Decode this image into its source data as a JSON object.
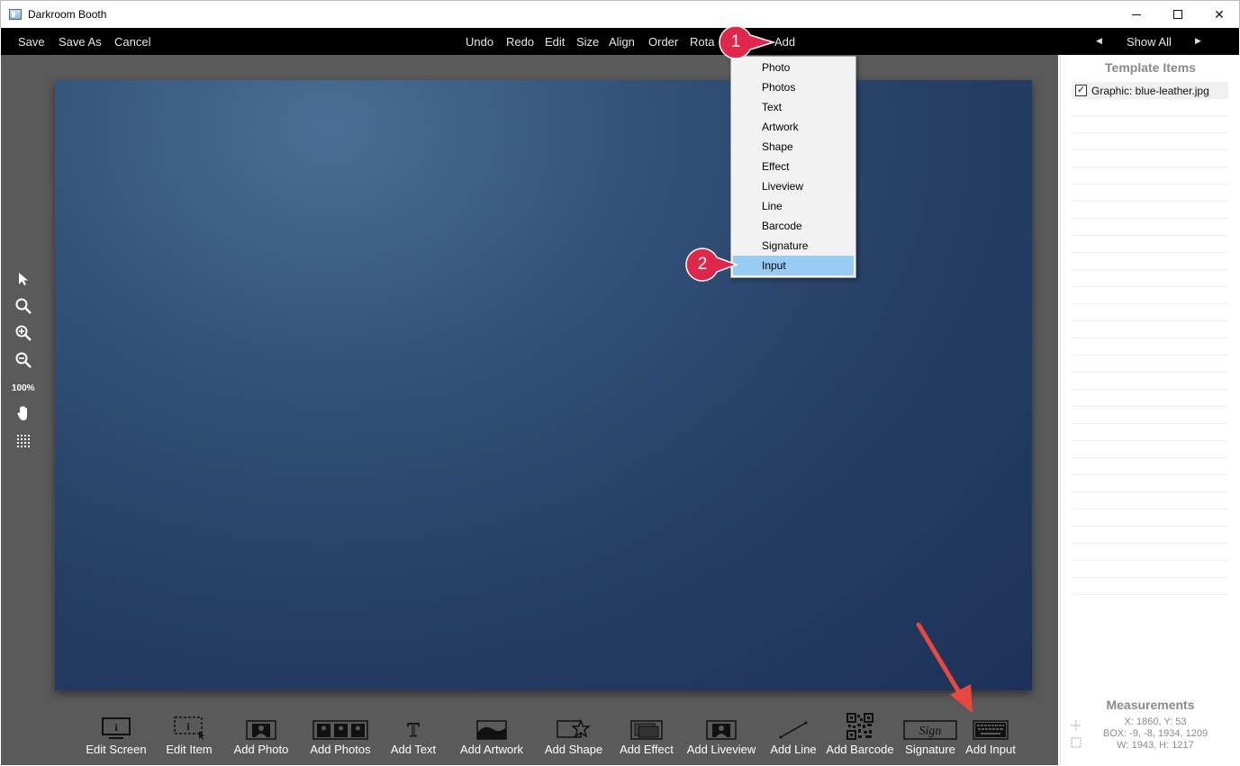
{
  "window": {
    "title": "Darkroom Booth",
    "minimize_glyph": "",
    "maximize_glyph": "",
    "close_glyph": "✕"
  },
  "menubar": {
    "save": "Save",
    "save_as": "Save As",
    "cancel": "Cancel",
    "undo": "Undo",
    "redo": "Redo",
    "edit": "Edit",
    "size": "Size",
    "align": "Align",
    "order": "Order",
    "rotate": "Rota",
    "add": "Add",
    "show_all": "Show All",
    "prev_glyph": "◀",
    "next_glyph": "▶"
  },
  "dropdown": {
    "items": [
      "Photo",
      "Photos",
      "Text",
      "Artwork",
      "Shape",
      "Effect",
      "Liveview",
      "Line",
      "Barcode",
      "Signature",
      "Input"
    ],
    "selected": "Input"
  },
  "callouts": {
    "first": "1",
    "second": "2"
  },
  "left_tools": {
    "zoom_label": "100%"
  },
  "bottom_toolbar": {
    "edit_screen": "Edit Screen",
    "edit_item": "Edit Item",
    "add_photo": "Add Photo",
    "add_photos": "Add Photos",
    "add_text": "Add Text",
    "add_artwork": "Add Artwork",
    "add_shape": "Add Shape",
    "add_effect": "Add Effect",
    "add_liveview": "Add Liveview",
    "add_line": "Add Line",
    "add_barcode": "Add Barcode",
    "signature": "Signature",
    "signature_icon_text": "Sign",
    "add_input": "Add Input"
  },
  "right_panel": {
    "title": "Template Items",
    "items": [
      {
        "label": "Graphic: blue-leather.jpg",
        "checked": true,
        "check_glyph": "✓"
      }
    ],
    "measurements_title": "Measurements",
    "xy": "X: 1860, Y: 53",
    "box": "BOX: -9, -8, 1934, 1209",
    "wh": "W: 1943, H: 1217"
  },
  "colors": {
    "menubar_bg": "#000000",
    "workspace_bg": "#5a5a5a",
    "callout_red": "#e0264a",
    "arrow_red": "#e8483e",
    "selected_item": "#99ccf3"
  }
}
